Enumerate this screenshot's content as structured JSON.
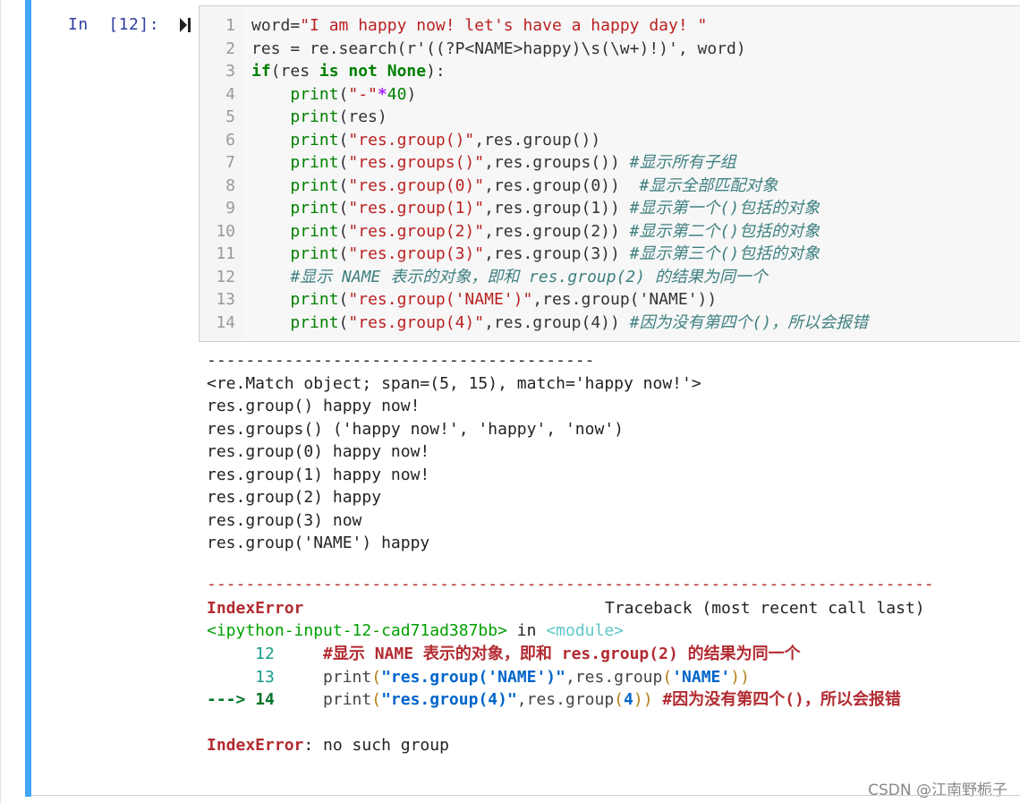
{
  "cell": {
    "prompt": "In  [12]:",
    "code_lines": [
      {
        "num": "1",
        "parts": [
          [
            "t",
            "word"
          ],
          [
            "o",
            "="
          ],
          [
            "s",
            "\"I am happy now! let's have a happy day! \""
          ]
        ]
      },
      {
        "num": "2",
        "parts": [
          [
            "t",
            "res = re.search(r'((?P<NAME>happy)\\s(\\w+)!)', word)"
          ]
        ]
      },
      {
        "num": "3",
        "parts": [
          [
            "k",
            "if"
          ],
          [
            "t",
            "(res "
          ],
          [
            "k",
            "is not None"
          ],
          [
            "t",
            "):"
          ]
        ]
      },
      {
        "num": "4",
        "parts": [
          [
            "t",
            "    "
          ],
          [
            "b",
            "print"
          ],
          [
            "t",
            "("
          ],
          [
            "s",
            "\"-\""
          ],
          [
            "p",
            "*"
          ],
          [
            "n",
            "40"
          ],
          [
            "t",
            ")"
          ]
        ]
      },
      {
        "num": "5",
        "parts": [
          [
            "t",
            "    "
          ],
          [
            "b",
            "print"
          ],
          [
            "t",
            "(res)"
          ]
        ]
      },
      {
        "num": "6",
        "parts": [
          [
            "t",
            "    "
          ],
          [
            "b",
            "print"
          ],
          [
            "t",
            "("
          ],
          [
            "s",
            "\"res.group()\""
          ],
          [
            "t",
            ",res.group())"
          ]
        ]
      },
      {
        "num": "7",
        "parts": [
          [
            "t",
            "    "
          ],
          [
            "b",
            "print"
          ],
          [
            "t",
            "("
          ],
          [
            "s",
            "\"res.groups()\""
          ],
          [
            "t",
            ",res.groups()) "
          ],
          [
            "c",
            "#显示所有子组"
          ]
        ]
      },
      {
        "num": "8",
        "parts": [
          [
            "t",
            "    "
          ],
          [
            "b",
            "print"
          ],
          [
            "t",
            "("
          ],
          [
            "s",
            "\"res.group(0)\""
          ],
          [
            "t",
            ",res.group(0))  "
          ],
          [
            "c",
            "#显示全部匹配对象"
          ]
        ]
      },
      {
        "num": "9",
        "parts": [
          [
            "t",
            "    "
          ],
          [
            "b",
            "print"
          ],
          [
            "t",
            "("
          ],
          [
            "s",
            "\"res.group(1)\""
          ],
          [
            "t",
            ",res.group(1)) "
          ],
          [
            "c",
            "#显示第一个()包括的对象"
          ]
        ]
      },
      {
        "num": "10",
        "parts": [
          [
            "t",
            "    "
          ],
          [
            "b",
            "print"
          ],
          [
            "t",
            "("
          ],
          [
            "s",
            "\"res.group(2)\""
          ],
          [
            "t",
            ",res.group(2)) "
          ],
          [
            "c",
            "#显示第二个()包括的对象"
          ]
        ]
      },
      {
        "num": "11",
        "parts": [
          [
            "t",
            "    "
          ],
          [
            "b",
            "print"
          ],
          [
            "t",
            "("
          ],
          [
            "s",
            "\"res.group(3)\""
          ],
          [
            "t",
            ",res.group(3)) "
          ],
          [
            "c",
            "#显示第三个()包括的对象"
          ]
        ]
      },
      {
        "num": "12",
        "parts": [
          [
            "t",
            "    "
          ],
          [
            "c",
            "#显示 NAME 表示的对象，即和 res.group(2) 的结果为同一个"
          ]
        ]
      },
      {
        "num": "13",
        "parts": [
          [
            "t",
            "    "
          ],
          [
            "b",
            "print"
          ],
          [
            "t",
            "("
          ],
          [
            "s",
            "\"res.group('NAME')\""
          ],
          [
            "t",
            ",res.group('NAME'))"
          ]
        ]
      },
      {
        "num": "14",
        "parts": [
          [
            "t",
            "    "
          ],
          [
            "b",
            "print"
          ],
          [
            "t",
            "("
          ],
          [
            "s",
            "\"res.group(4)\""
          ],
          [
            "t",
            ",res.group(4)) "
          ],
          [
            "c",
            "#因为没有第四个()，所以会报错"
          ]
        ]
      }
    ]
  },
  "output": {
    "stdout": [
      "----------------------------------------",
      "<re.Match object; span=(5, 15), match='happy now!'>",
      "res.group() happy now!",
      "res.groups() ('happy now!', 'happy', 'now')",
      "res.group(0) happy now!",
      "res.group(1) happy now!",
      "res.group(2) happy",
      "res.group(3) now",
      "res.group('NAME') happy"
    ],
    "error": {
      "separator": "---------------------------------------------------------------------------",
      "name": "IndexError",
      "traceback_header": "Traceback (most recent call last)",
      "location_file": "<ipython-input-12-cad71ad387bb>",
      "location_in": " in ",
      "location_module": "<module>",
      "tb_lines": [
        {
          "num": "12",
          "text": "#显示 NAME 表示的对象，即和 res.group(2) 的结果为同一个"
        },
        {
          "num": "13",
          "code_fn": "print",
          "code_str": "\"res.group('NAME')\"",
          "code_rest": ",res.group('NAME'))"
        },
        {
          "arrow": "---> ",
          "num": "14",
          "code_fn": "print",
          "code_str": "\"res.group(4)\"",
          "code_rest": ",res.group(4)) ",
          "comment": "#因为没有第四个()，所以会报错"
        }
      ],
      "message": ": no such group"
    }
  },
  "watermark": "CSDN @江南野栀子",
  "colors": {
    "cell_bar": "#42a5f5",
    "keyword": "#008000",
    "string": "#ba2121",
    "comment": "#408080",
    "error": "#b22b31"
  }
}
